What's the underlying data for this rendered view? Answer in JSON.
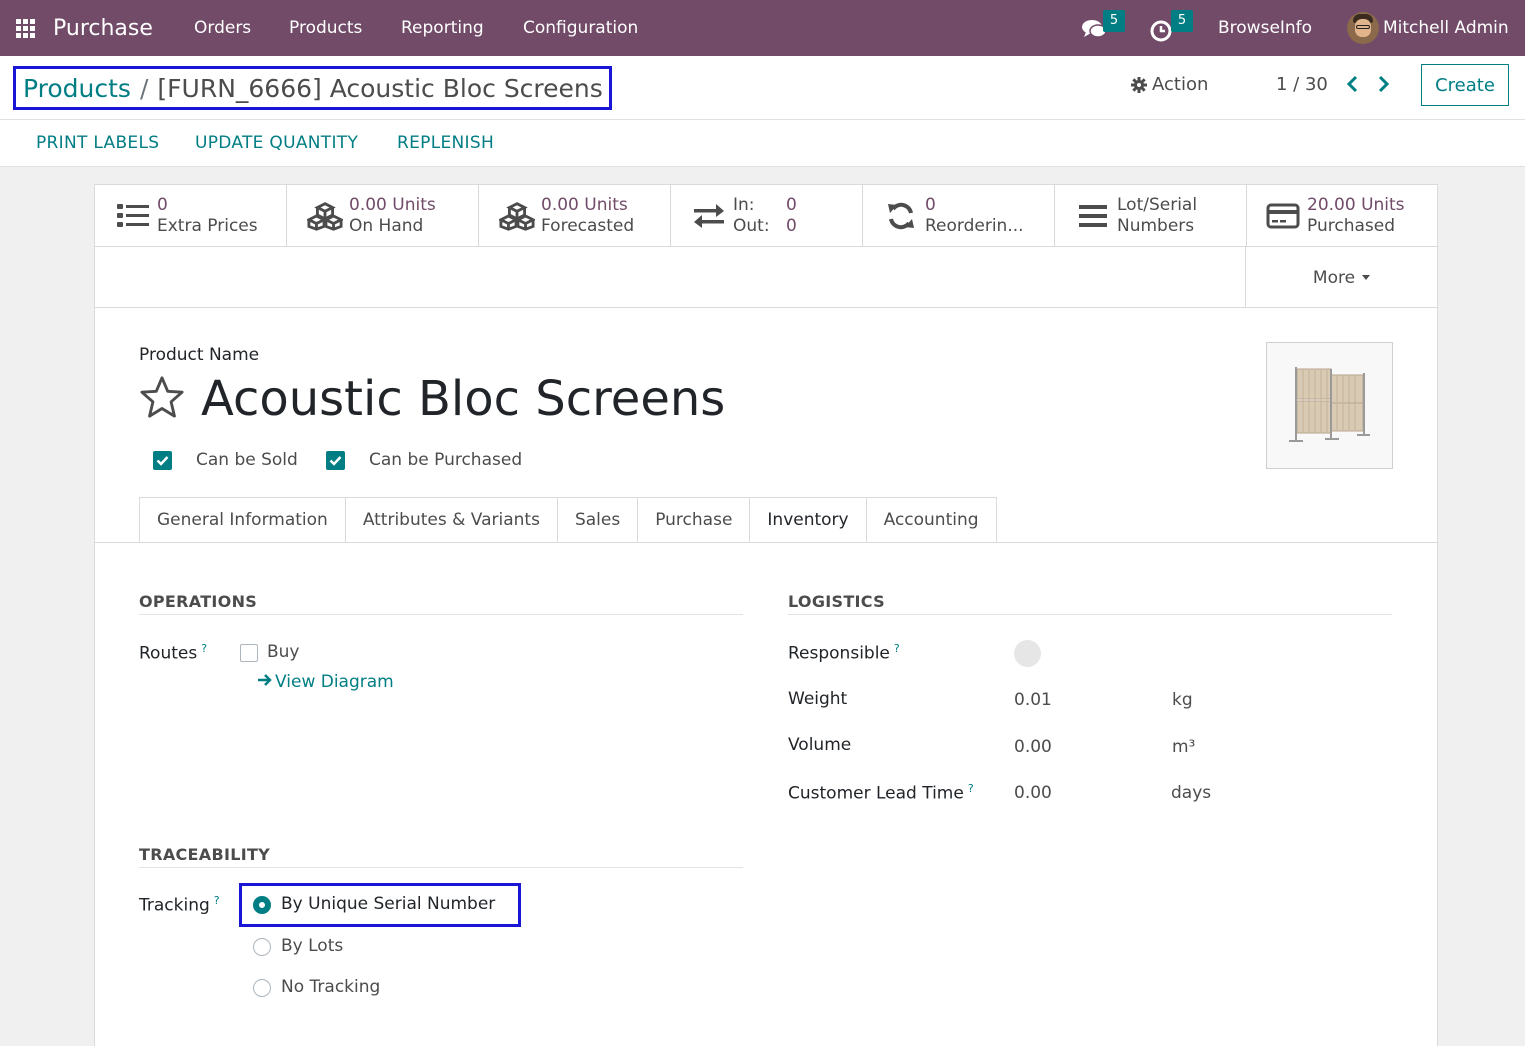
{
  "navbar": {
    "app_name": "Purchase",
    "menu": [
      "Orders",
      "Products",
      "Reporting",
      "Configuration"
    ],
    "messages_count": "5",
    "activities_count": "5",
    "company": "BrowseInfo",
    "user": "Mitchell Admin",
    "bg_color": "#714b67"
  },
  "breadcrumb": {
    "parent": "Products",
    "separator": "/",
    "current": "[FURN_6666] Acoustic Bloc Screens"
  },
  "control": {
    "action_label": "Action",
    "pager": "1 / 30",
    "create_label": "Create"
  },
  "status_buttons": [
    "PRINT LABELS",
    "UPDATE QUANTITY",
    "REPLENISH"
  ],
  "smart_buttons": {
    "extra_prices": {
      "value": "0",
      "label": "Extra Prices"
    },
    "on_hand": {
      "value": "0.00 Units",
      "label": "On Hand"
    },
    "forecasted": {
      "value": "0.00 Units",
      "label": "Forecasted"
    },
    "in_out": {
      "in_label": "In:",
      "in_value": "0",
      "out_label": "Out:",
      "out_value": "0"
    },
    "reordering": {
      "value": "0",
      "label": "Reorderin..."
    },
    "lot_serial": {
      "line1": "Lot/Serial",
      "line2": "Numbers"
    },
    "purchased": {
      "value": "20.00 Units",
      "label": "Purchased"
    },
    "more": "More"
  },
  "product": {
    "name_label": "Product Name",
    "name": "Acoustic Bloc Screens",
    "can_be_sold": "Can be Sold",
    "can_be_purchased": "Can be Purchased"
  },
  "tabs": [
    "General Information",
    "Attributes & Variants",
    "Sales",
    "Purchase",
    "Inventory",
    "Accounting"
  ],
  "active_tab": "Inventory",
  "operations": {
    "title": "OPERATIONS",
    "routes_label": "Routes",
    "help": "?",
    "route_buy": "Buy",
    "view_diagram": "View Diagram"
  },
  "logistics": {
    "title": "LOGISTICS",
    "responsible_label": "Responsible",
    "weight_label": "Weight",
    "weight_value": "0.01",
    "weight_unit": "kg",
    "volume_label": "Volume",
    "volume_value": "0.00",
    "volume_unit": "m³",
    "lead_label": "Customer Lead Time",
    "lead_value": "0.00",
    "lead_unit": "days"
  },
  "traceability": {
    "title": "TRACEABILITY",
    "tracking_label": "Tracking",
    "options": [
      "By Unique Serial Number",
      "By Lots",
      "No Tracking"
    ],
    "selected": "By Unique Serial Number"
  },
  "colors": {
    "primary": "#017e84",
    "brand": "#714b67",
    "highlight": "#1a16d6"
  }
}
